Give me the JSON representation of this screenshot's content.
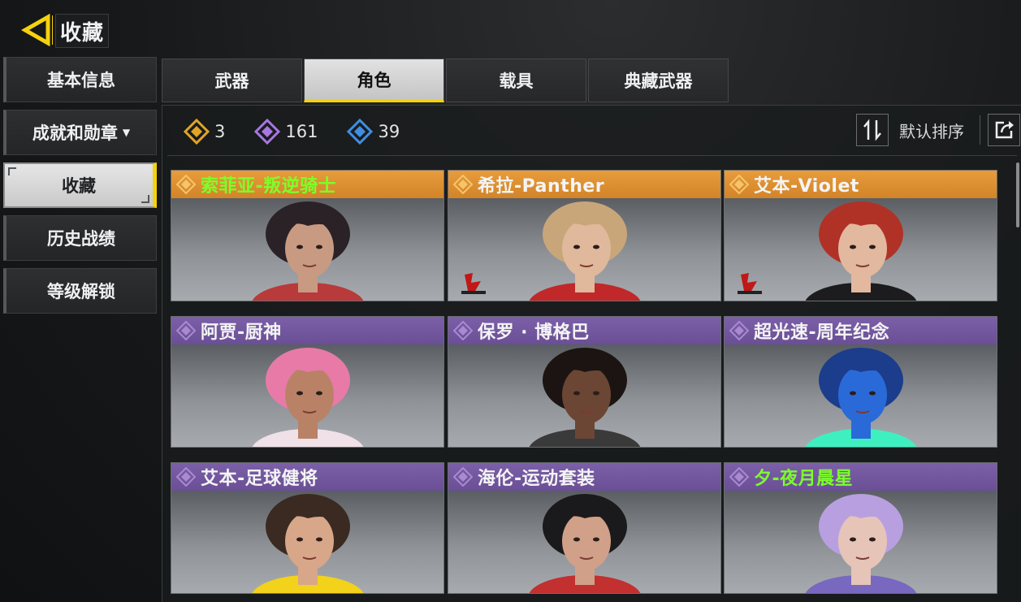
{
  "header": {
    "title": "收藏"
  },
  "sidebar": {
    "items": [
      {
        "label": "基本信息"
      },
      {
        "label": "成就和勋章"
      },
      {
        "label": "收藏"
      },
      {
        "label": "历史战绩"
      },
      {
        "label": "等级解锁"
      }
    ],
    "active_index": 2
  },
  "tabs": [
    {
      "label": "武器"
    },
    {
      "label": "角色"
    },
    {
      "label": "载具"
    },
    {
      "label": "典藏武器"
    }
  ],
  "active_tab": 1,
  "stats": [
    {
      "rarity": "legendary",
      "color": "#e0a526",
      "count": "3"
    },
    {
      "rarity": "epic",
      "color": "#a876e0",
      "count": "161"
    },
    {
      "rarity": "rare",
      "color": "#3f8ee3",
      "count": "39"
    }
  ],
  "sort": {
    "label": "默认排序"
  },
  "cards": [
    {
      "name": "索菲亚-叛逆骑士",
      "rarity": "legendary",
      "head_color": "#e89c3c",
      "name_color_highlight": true,
      "hair": "#2a2226",
      "skin": "#c89a82",
      "accent": "#b83a3a",
      "badge": false
    },
    {
      "name": "希拉-Panther",
      "rarity": "legendary",
      "head_color": "#e89c3c",
      "name_color_highlight": false,
      "hair": "#c9a67a",
      "skin": "#e0b89c",
      "accent": "#c0282a",
      "badge": true
    },
    {
      "name": "艾本-Violet",
      "rarity": "legendary",
      "head_color": "#e89c3c",
      "name_color_highlight": false,
      "hair": "#b03226",
      "skin": "#e2b89e",
      "accent": "#1c1c1e",
      "badge": true
    },
    {
      "name": "阿贾-厨神",
      "rarity": "epic",
      "head_color": "#7b5fa8",
      "name_color_highlight": false,
      "hair": "#e87aa8",
      "skin": "#b98266",
      "accent": "#f0e0e8",
      "badge": false
    },
    {
      "name": "保罗 · 博格巴",
      "rarity": "epic",
      "head_color": "#7b5fa8",
      "name_color_highlight": false,
      "hair": "#1b1412",
      "skin": "#6b4634",
      "accent": "#3a3a3a",
      "badge": false
    },
    {
      "name": "超光速-周年纪念",
      "rarity": "epic",
      "head_color": "#7b5fa8",
      "name_color_highlight": false,
      "hair": "#1c3c8c",
      "skin": "#2a6ad8",
      "accent": "#3ef0c0",
      "badge": false
    },
    {
      "name": "艾本-足球健将",
      "rarity": "epic",
      "head_color": "#7b5fa8",
      "name_color_highlight": false,
      "hair": "#3a2a22",
      "skin": "#d8a688",
      "accent": "#f2d21a",
      "badge": false
    },
    {
      "name": "海伦-运动套装",
      "rarity": "epic",
      "head_color": "#7b5fa8",
      "name_color_highlight": false,
      "hair": "#1a1a1c",
      "skin": "#d0a088",
      "accent": "#c23030",
      "badge": false
    },
    {
      "name": "夕-夜月晨星",
      "rarity": "epic",
      "head_color": "#7b5fa8",
      "name_color_highlight": true,
      "hair": "#b8a0e0",
      "skin": "#e6c4b8",
      "accent": "#7868c0",
      "badge": false
    }
  ]
}
